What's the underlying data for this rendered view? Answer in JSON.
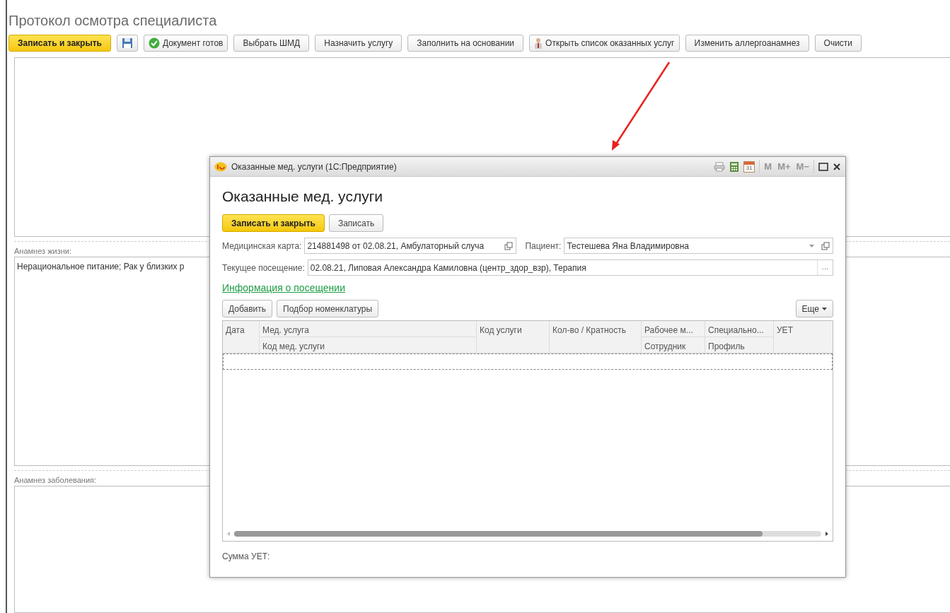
{
  "form": {
    "title": "Протокол осмотра специалиста",
    "toolbar": [
      {
        "kind": "primary",
        "label": "Записать и закрыть"
      },
      {
        "kind": "save"
      },
      {
        "kind": "ready",
        "label": "Документ готов"
      },
      {
        "kind": "plain",
        "label": "Выбрать ШМД"
      },
      {
        "kind": "plain",
        "label": "Назначить услугу"
      },
      {
        "kind": "plain",
        "label": "Заполнить на основании"
      },
      {
        "kind": "person",
        "label": "Открыть список оказанных услуг"
      },
      {
        "kind": "plain",
        "label": "Изменить аллергоанамнез"
      },
      {
        "kind": "plain",
        "label": "Очисти"
      }
    ],
    "sections": [
      {
        "label": "Анамнез жизни:",
        "value": "Нерациональное питание; Рак у близких р"
      },
      {
        "label": "Анамнез заболевания:"
      }
    ]
  },
  "dialog": {
    "window_title": "Оказанные мед. услуги (1С:Предприятие)",
    "calendar_day": "31",
    "memory_buttons": [
      {
        "label": "M",
        "disabled": true
      },
      {
        "label": "M+",
        "disabled": true
      },
      {
        "label": "M−",
        "disabled": true
      }
    ],
    "heading": "Оказанные мед. услуги",
    "buttons": [
      {
        "kind": "primary",
        "label": "Записать и закрыть"
      },
      {
        "kind": "plain",
        "label": "Записать"
      }
    ],
    "medical_card": {
      "label": "Медицинская карта:",
      "value": "214881498 от 02.08.21, Амбулаторный случа"
    },
    "patient": {
      "label": "Пациент:",
      "value": "Тестешева Яна Владимировна"
    },
    "visit": {
      "label": "Текущее посещение:",
      "value": "02.08.21, Липовая Александра Камиловна (центр_здор_взр), Терапия",
      "button": "..."
    },
    "link": "Информация о посещении",
    "table_buttons": [
      "Добавить",
      "Подбор номенклатуры"
    ],
    "more_button": "Еще",
    "table": {
      "columns": [
        {
          "top": "Дата"
        },
        {
          "top": "Мед. услуга",
          "bottom": "Код мед. услуги"
        },
        {
          "top": "Код услуги"
        },
        {
          "top": "Кол-во / Кратность"
        },
        {
          "top": "Рабочее м...",
          "bottom": "Сотрудник"
        },
        {
          "top": "Специально...",
          "bottom": "Профиль"
        },
        {
          "top": "УЕТ"
        }
      ]
    },
    "footer": "Сумма УЕТ:"
  }
}
